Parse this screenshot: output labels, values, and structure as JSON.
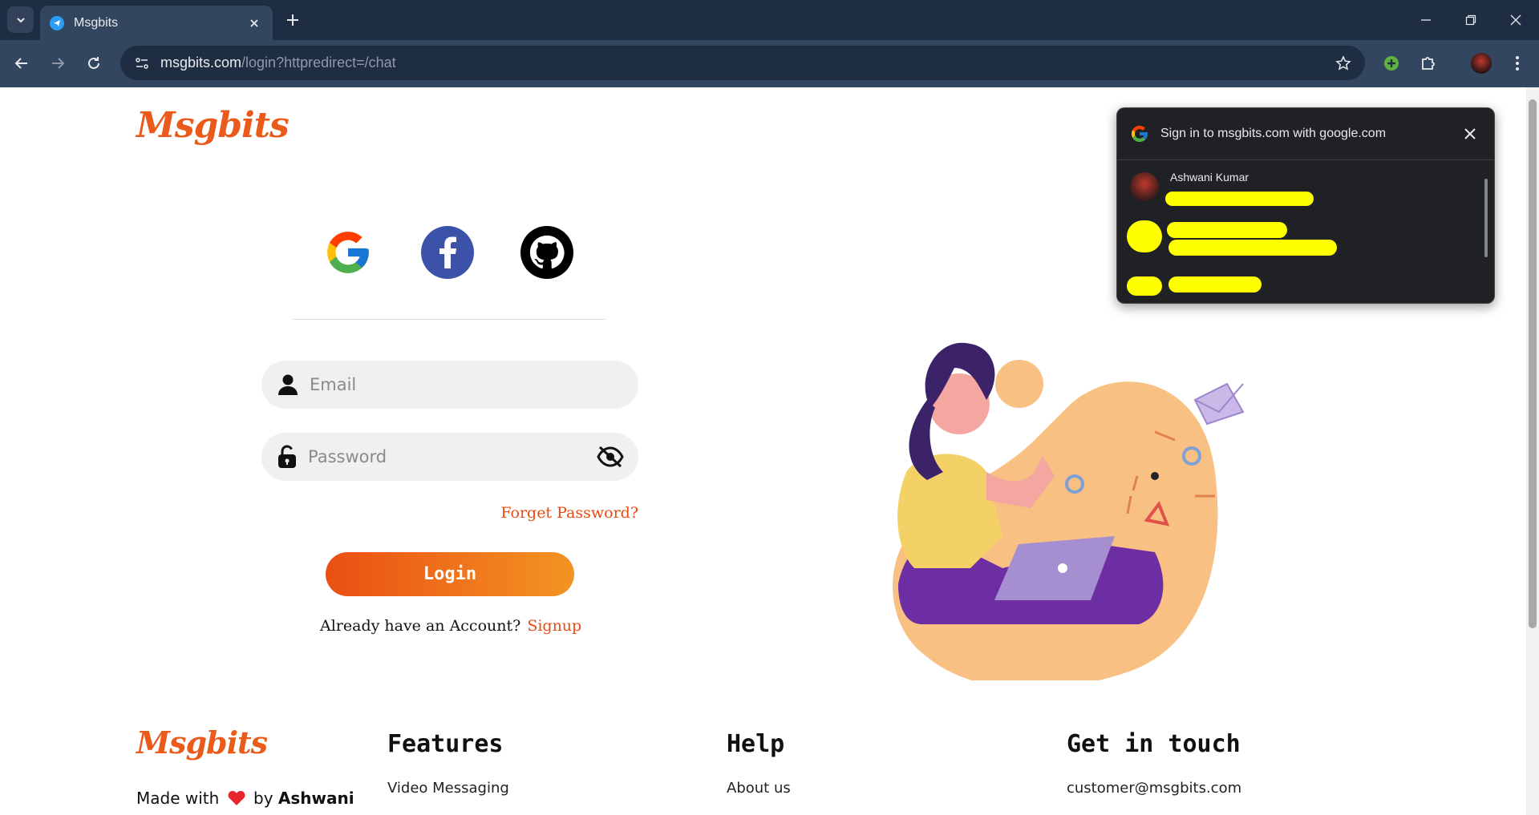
{
  "browser": {
    "tab_title": "Msgbits",
    "url_host": "msgbits.com",
    "url_path": "/login?httpredirect=/chat"
  },
  "page": {
    "brand": "Msgbits",
    "social": {
      "google_icon": "google-icon",
      "facebook_icon": "facebook-icon",
      "github_icon": "github-icon"
    },
    "email_placeholder": "Email",
    "password_placeholder": "Password",
    "forgot_label": "Forget Password?",
    "login_label": "Login",
    "account_prompt": "Already have an Account?",
    "signup_label": "Signup"
  },
  "footer": {
    "brand": "Msgbits",
    "made_prefix": "Made with",
    "made_by": "by",
    "made_name": "Ashwani",
    "features_heading": "Features",
    "features_item": "Video Messaging",
    "help_heading": "Help",
    "help_item": "About us",
    "contact_heading": "Get in touch",
    "contact_email": "customer@msgbits.com"
  },
  "google_popup": {
    "title": "Sign in to msgbits.com with google.com",
    "account_name": "Ashwani Kumar"
  },
  "colors": {
    "accent": "#ea5a1b",
    "login_gradient_start": "#ea4f12",
    "login_gradient_end": "#f39423",
    "chrome_dark": "#1f2d42",
    "chrome_toolbar": "#33465f"
  }
}
